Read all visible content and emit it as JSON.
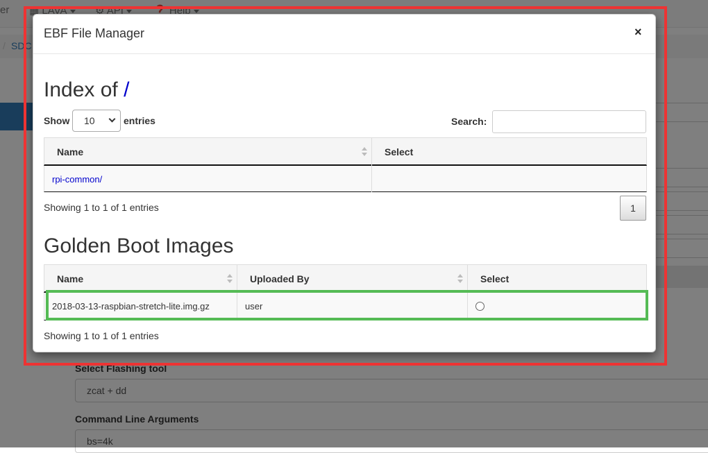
{
  "background": {
    "nav": {
      "brand_tail": "er",
      "items": [
        {
          "label": "LAVA",
          "icon": "calendar-icon"
        },
        {
          "label": "API",
          "icon": "gear-icon"
        },
        {
          "label": "Help",
          "icon": "question-circle-icon"
        }
      ]
    },
    "breadcrumb": {
      "separator": "/",
      "crumb": "SDC"
    },
    "form": {
      "flashing_tool_label": "Select Flashing tool",
      "flashing_tool_value": "zcat + dd",
      "cmdline_label": "Command Line Arguments",
      "cmdline_value": "bs=4k"
    }
  },
  "modal": {
    "title": "EBF File Manager",
    "close_label": "×",
    "index": {
      "heading_prefix": "Index of ",
      "heading_path": "/",
      "show_label": "Show",
      "entries_value": "10",
      "entries_label": "entries",
      "search_label": "Search:",
      "search_value": "",
      "columns": [
        "Name",
        "Select"
      ],
      "rows": [
        {
          "name": "rpi-common/",
          "select": ""
        }
      ],
      "info": "Showing 1 to 1 of 1 entries",
      "page": "1"
    },
    "golden": {
      "heading": "Golden Boot Images",
      "columns": [
        "Name",
        "Uploaded By",
        "Select"
      ],
      "rows": [
        {
          "name": "2018-03-13-raspbian-stretch-lite.img.gz",
          "uploaded_by": "user",
          "selected": false
        }
      ],
      "info": "Showing 1 to 1 of 1 entries"
    }
  },
  "colors": {
    "annotation_red": "#ee3333",
    "annotation_green": "#55bb55",
    "link": "#0000cc",
    "primary": "#337ab7"
  }
}
